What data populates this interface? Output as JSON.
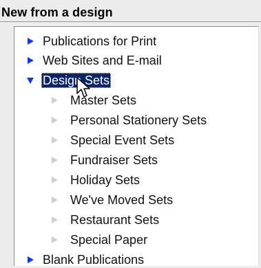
{
  "section": {
    "title": "New from a design"
  },
  "tree": {
    "items": [
      {
        "label": "Publications for Print",
        "icon": "chevron-right-icon",
        "state": "collapsed"
      },
      {
        "label": "Web Sites and E-mail",
        "icon": "chevron-right-icon",
        "state": "collapsed"
      },
      {
        "label": "Design Sets",
        "icon": "chevron-down-icon",
        "state": "expanded",
        "selected": true,
        "children": [
          {
            "label": "Master Sets",
            "icon": "chevron-right-icon"
          },
          {
            "label": "Personal Stationery Sets",
            "icon": "chevron-right-icon"
          },
          {
            "label": "Special Event Sets",
            "icon": "chevron-right-icon"
          },
          {
            "label": "Fundraiser Sets",
            "icon": "chevron-right-icon"
          },
          {
            "label": "Holiday Sets",
            "icon": "chevron-right-icon"
          },
          {
            "label": "We've Moved Sets",
            "icon": "chevron-right-icon"
          },
          {
            "label": "Restaurant Sets",
            "icon": "chevron-right-icon"
          },
          {
            "label": "Special Paper",
            "icon": "chevron-right-icon"
          }
        ]
      },
      {
        "label": "Blank Publications",
        "icon": "chevron-right-icon",
        "state": "collapsed"
      }
    ]
  },
  "colors": {
    "accent_arrow": "#1038e8",
    "muted_arrow": "#cfcfcf",
    "selection_background": "#0a246a",
    "selection_text": "#ffffff",
    "panel_background": "#ffffff",
    "header_background": "#ececec"
  }
}
